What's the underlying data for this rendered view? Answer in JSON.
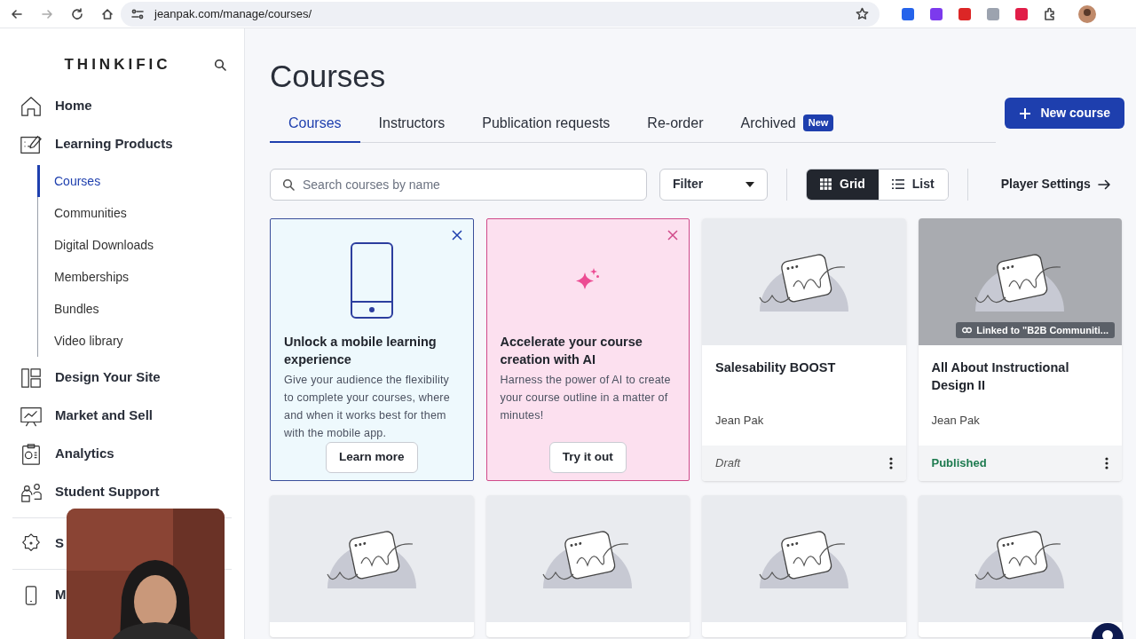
{
  "browser": {
    "url": "jeanpak.com/manage/courses/"
  },
  "sidebar": {
    "logo": "THINKIFIC",
    "items": [
      {
        "kind": "home",
        "label": "Home",
        "selected": false
      },
      {
        "kind": "learning",
        "label": "Learning Products",
        "selected": false,
        "children": [
          {
            "label": "Courses",
            "selected": true
          },
          {
            "label": "Communities",
            "selected": false
          },
          {
            "label": "Digital Downloads",
            "selected": false
          },
          {
            "label": "Memberships",
            "selected": false
          },
          {
            "label": "Bundles",
            "selected": false
          },
          {
            "label": "Video library",
            "selected": false
          }
        ]
      },
      {
        "kind": "design",
        "label": "Design Your Site",
        "selected": false
      },
      {
        "kind": "market",
        "label": "Market and Sell",
        "selected": false
      },
      {
        "kind": "analytics",
        "label": "Analytics",
        "selected": false
      },
      {
        "kind": "support",
        "label": "Student Support",
        "selected": false
      },
      {
        "kind": "settings",
        "label": "S",
        "selected": false
      },
      {
        "kind": "mobile",
        "label": "M",
        "selected": false
      }
    ]
  },
  "page_title": "Courses",
  "tabs": [
    {
      "label": "Courses",
      "selected": true
    },
    {
      "label": "Instructors",
      "selected": false
    },
    {
      "label": "Publication requests",
      "selected": false
    },
    {
      "label": "Re-order",
      "selected": false
    },
    {
      "label": "Archived",
      "selected": false,
      "badge": "New"
    }
  ],
  "new_course_button": "New course",
  "search": {
    "placeholder": "Search courses by name"
  },
  "filter": "Filter",
  "view_toggle": [
    {
      "label": "Grid",
      "selected": true
    },
    {
      "label": "List",
      "selected": false
    }
  ],
  "player_settings": "Player Settings",
  "promo_cards": [
    {
      "kind": "mobile",
      "title": "Unlock a mobile learning experience",
      "description": "Give your audience the flexibility to complete your courses, where and when it works best for them with the mobile app.",
      "button": "Learn more"
    },
    {
      "kind": "ai",
      "title": "Accelerate your course creation with AI",
      "description": "Harness the power of AI to create your course outline in a matter of minutes!",
      "button": "Try it out"
    }
  ],
  "courses": [
    {
      "kind": "course",
      "title": "Salesability BOOST",
      "author": "Jean Pak",
      "status": "Draft",
      "published": false
    },
    {
      "kind": "course",
      "title": "All About Instructional Design II",
      "author": "Jean Pak",
      "status": "Published",
      "published": true,
      "link_badge": "Linked to \"B2B Communiti..."
    },
    {
      "kind": "partial"
    },
    {
      "kind": "partial"
    },
    {
      "kind": "partial"
    },
    {
      "kind": "partial"
    }
  ]
}
